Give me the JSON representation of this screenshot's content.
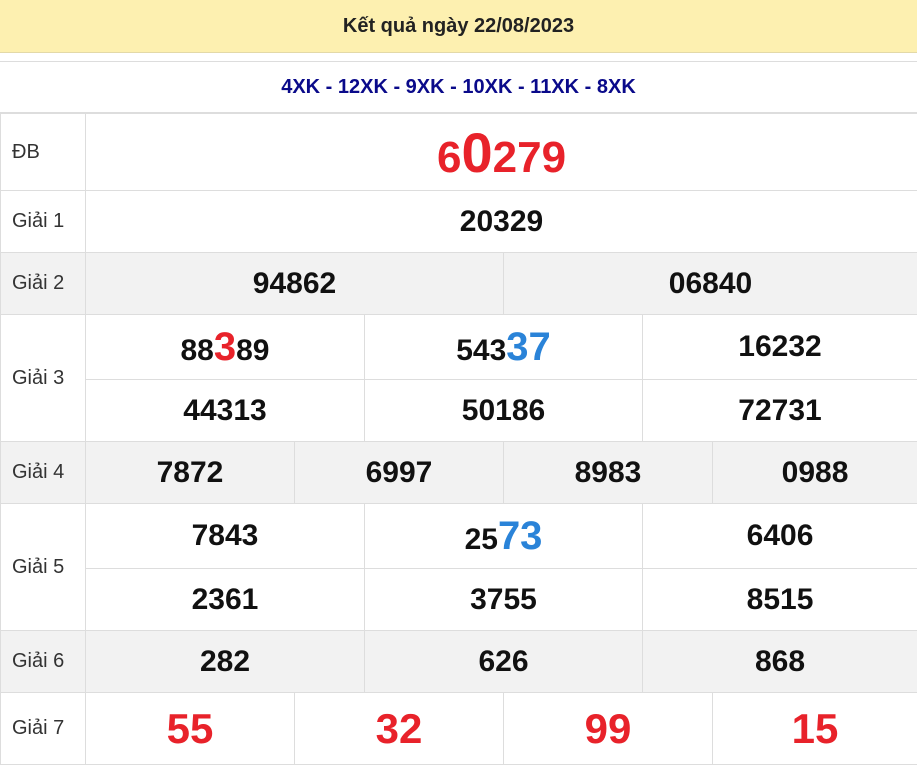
{
  "header": {
    "title": "Kết quả ngày 22/08/2023"
  },
  "codes": "4XK - 12XK - 9XK - 10XK - 11XK - 8XK",
  "special": {
    "label": "ĐB",
    "parts": [
      "6",
      "0",
      "279"
    ]
  },
  "giai1": {
    "label": "Giải 1",
    "values": [
      "20329"
    ]
  },
  "giai2": {
    "label": "Giải 2",
    "values": [
      "94862",
      "06840"
    ]
  },
  "giai3": {
    "label": "Giải 3",
    "rows": [
      [
        {
          "pre": "88",
          "hl": "3",
          "post": "89"
        },
        {
          "pre": "543",
          "hl": "37",
          "post": ""
        },
        {
          "pre": "16232",
          "hl": "",
          "post": ""
        }
      ],
      [
        {
          "pre": "44313",
          "hl": "",
          "post": ""
        },
        {
          "pre": "50186",
          "hl": "",
          "post": ""
        },
        {
          "pre": "72731",
          "hl": "",
          "post": ""
        }
      ]
    ]
  },
  "giai4": {
    "label": "Giải 4",
    "values": [
      "7872",
      "6997",
      "8983",
      "0988"
    ]
  },
  "giai5": {
    "label": "Giải 5",
    "rows": [
      [
        {
          "pre": "7843",
          "hl": "",
          "post": ""
        },
        {
          "pre": "25",
          "hl": "73",
          "post": ""
        },
        {
          "pre": "6406",
          "hl": "",
          "post": ""
        }
      ],
      [
        {
          "pre": "2361",
          "hl": "",
          "post": ""
        },
        {
          "pre": "3755",
          "hl": "",
          "post": ""
        },
        {
          "pre": "8515",
          "hl": "",
          "post": ""
        }
      ]
    ]
  },
  "giai6": {
    "label": "Giải 6",
    "values": [
      "282",
      "626",
      "868"
    ]
  },
  "giai7": {
    "label": "Giải 7",
    "values": [
      "55",
      "32",
      "99",
      "15"
    ]
  },
  "colors": {
    "header_bg": "#fdf0b0",
    "code_text": "#0a0a8a",
    "red": "#e8222a",
    "blue": "#2a83d8",
    "shade": "#f2f2f2"
  }
}
